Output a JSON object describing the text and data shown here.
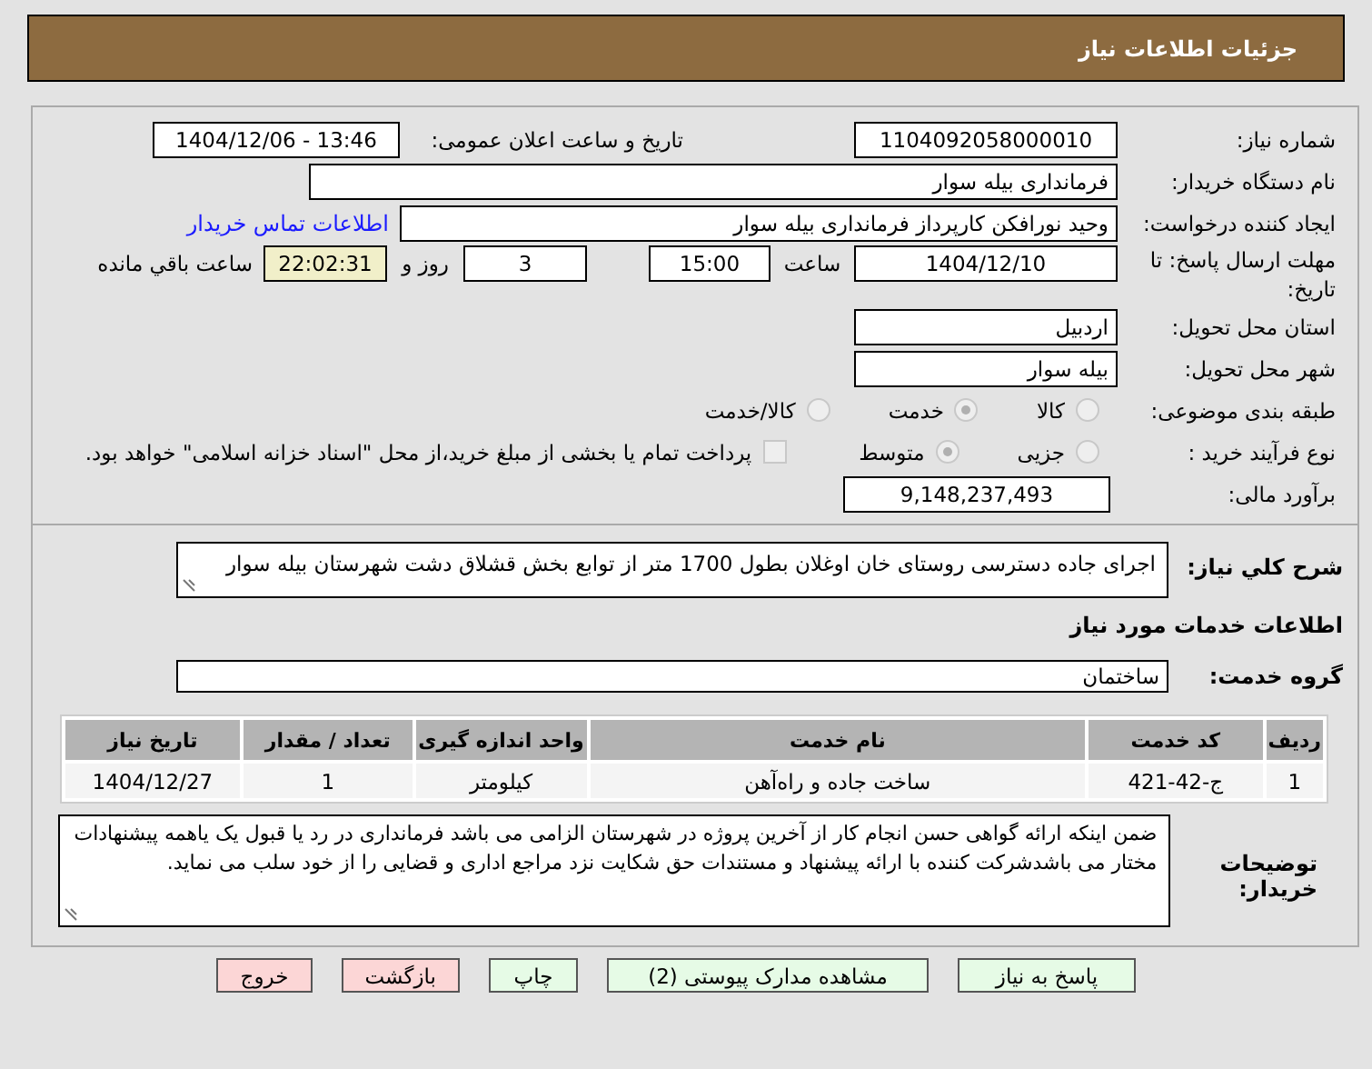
{
  "header": {
    "title": "جزئیات اطلاعات نیاز"
  },
  "need_number": {
    "label": "شماره نیاز:",
    "value": "1104092058000010"
  },
  "announce": {
    "label": "تاریخ و ساعت اعلان عمومی:",
    "value": "1404/12/06 - 13:46"
  },
  "buyer_org": {
    "label": "نام دستگاه خریدار:",
    "value": "فرمانداری بیله سوار"
  },
  "creator": {
    "label": "ایجاد کننده درخواست:",
    "value": "وحید نورافکن کارپرداز فرمانداری بیله سوار",
    "link": "اطلاعات تماس خریدار"
  },
  "deadline": {
    "label": "مهلت ارسال پاسخ: تا تاریخ:",
    "date": "1404/12/10",
    "time_label": "ساعت",
    "time": "15:00",
    "days": "3",
    "days_label": "روز و",
    "remaining": "22:02:31",
    "remaining_label": "ساعت باقي مانده"
  },
  "province": {
    "label": "استان محل تحویل:",
    "value": "اردبیل"
  },
  "city": {
    "label": "شهر محل تحویل:",
    "value": "بیله سوار"
  },
  "category": {
    "label": "طبقه بندی موضوعی:",
    "options": [
      {
        "label": "کالا",
        "selected": false
      },
      {
        "label": "خدمت",
        "selected": true
      },
      {
        "label": "کالا/خدمت",
        "selected": false
      }
    ]
  },
  "process": {
    "label": "نوع فرآیند خرید :",
    "options": [
      {
        "label": "جزیی",
        "selected": false
      },
      {
        "label": "متوسط",
        "selected": true
      }
    ],
    "payment": {
      "label": "پرداخت تمام یا بخشی از مبلغ خرید،از محل \"اسناد خزانه اسلامی\" خواهد بود.",
      "checked": false
    }
  },
  "estimate": {
    "label": "برآورد مالی:",
    "value": "9,148,237,493"
  },
  "description": {
    "label": "شرح کلي نياز:",
    "value": "اجرای جاده دسترسی روستای خان اوغلان بطول 1700 متر از توابع بخش قشلاق دشت شهرستان بیله سوار"
  },
  "services_title": "اطلاعات خدمات مورد نیاز",
  "service_group": {
    "label": "گروه خدمت:",
    "value": "ساختمان"
  },
  "table": {
    "columns": [
      "ردیف",
      "کد خدمت",
      "نام خدمت",
      "واحد اندازه گیری",
      "تعداد / مقدار",
      "تاریخ نیاز"
    ],
    "rows": [
      [
        "1",
        "ج-42-421",
        "ساخت جاده و راه‌آهن",
        "کیلومتر",
        "1",
        "1404/12/27"
      ]
    ]
  },
  "buyer_notes": {
    "label": "توضیحات خریدار:",
    "value": "ضمن اینکه ارائه گواهی حسن انجام کار از آخرین پروژه در شهرستان الزامی می باشد فرمانداری در رد یا قبول یک یاهمه پیشنهادات مختار می باشدشرکت کننده با ارائه پیشنهاد و مستندات حق شکایت نزد مراجع اداری و قضایی را از خود سلب می نماید."
  },
  "buttons": [
    {
      "label": "پاسخ به نیاز",
      "kind": "normal"
    },
    {
      "label": "مشاهده مدارک پیوستی (2)",
      "kind": "normal"
    },
    {
      "label": "چاپ",
      "kind": "normal"
    },
    {
      "label": "بازگشت",
      "kind": "danger"
    },
    {
      "label": "خروج",
      "kind": "danger"
    }
  ]
}
